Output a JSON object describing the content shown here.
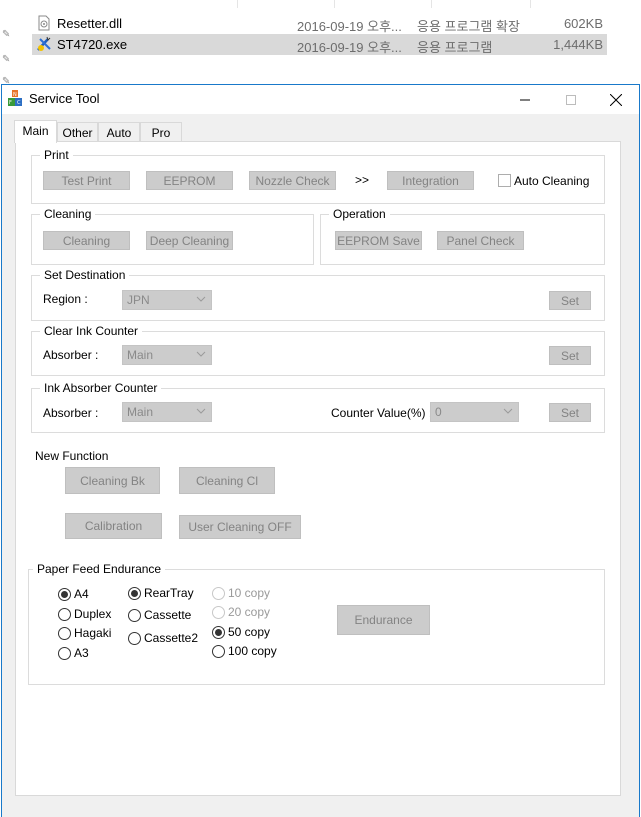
{
  "explorer": {
    "files": [
      {
        "name": "Resetter.dll",
        "date": "2016-09-19 오후...",
        "type": "응용 프로그램 확장",
        "size": "602KB",
        "icon": "dll-file-icon",
        "selected": false
      },
      {
        "name": "ST4720.exe",
        "date": "2016-09-19 오후...",
        "type": "응용 프로그램",
        "size": "1,444KB",
        "icon": "exe-app-icon",
        "selected": true
      }
    ]
  },
  "window": {
    "title": "Service Tool",
    "controls": {
      "minimize": "minimize-icon",
      "maximize": "maximize-icon",
      "close": "close-icon"
    }
  },
  "tabs": [
    {
      "label": "Main",
      "active": true
    },
    {
      "label": "Other",
      "active": false
    },
    {
      "label": "Auto",
      "active": false
    },
    {
      "label": "Pro",
      "active": false
    }
  ],
  "print_group": {
    "title": "Print",
    "buttons": [
      "Test Print",
      "EEPROM",
      "Nozzle Check",
      "Integration"
    ],
    "separator": ">>",
    "auto_cleaning": {
      "label": "Auto Cleaning",
      "checked": false
    }
  },
  "cleaning_group": {
    "title": "Cleaning",
    "buttons": [
      "Cleaning",
      "Deep Cleaning"
    ]
  },
  "operation_group": {
    "title": "Operation",
    "buttons": [
      "EEPROM Save",
      "Panel Check"
    ]
  },
  "set_destination": {
    "title": "Set Destination",
    "label": "Region :",
    "value": "JPN",
    "set_label": "Set"
  },
  "clear_ink_counter": {
    "title": "Clear Ink Counter",
    "label": "Absorber :",
    "value": "Main",
    "set_label": "Set"
  },
  "ink_absorber_counter": {
    "title": "Ink Absorber Counter",
    "label": "Absorber :",
    "value": "Main",
    "counter_label": "Counter Value(%) :",
    "counter_value": "0",
    "set_label": "Set"
  },
  "new_function": {
    "title": "New Function",
    "buttons": [
      "Cleaning Bk",
      "Cleaning Cl",
      "Calibration",
      "User Cleaning OFF"
    ]
  },
  "paper_feed": {
    "title": "Paper Feed Endurance",
    "paper": [
      {
        "label": "A4",
        "checked": true
      },
      {
        "label": "Duplex",
        "checked": false
      },
      {
        "label": "Hagaki",
        "checked": false
      },
      {
        "label": "A3",
        "checked": false
      }
    ],
    "source": [
      {
        "label": "RearTray",
        "checked": true
      },
      {
        "label": "Cassette",
        "checked": false
      },
      {
        "label": "Cassette2",
        "checked": false
      }
    ],
    "copies": [
      {
        "label": "10 copy",
        "checked": false,
        "disabled": true
      },
      {
        "label": "20 copy",
        "checked": false,
        "disabled": true
      },
      {
        "label": "50 copy",
        "checked": true,
        "disabled": false
      },
      {
        "label": "100 copy",
        "checked": false,
        "disabled": false
      }
    ],
    "endurance_label": "Endurance"
  }
}
